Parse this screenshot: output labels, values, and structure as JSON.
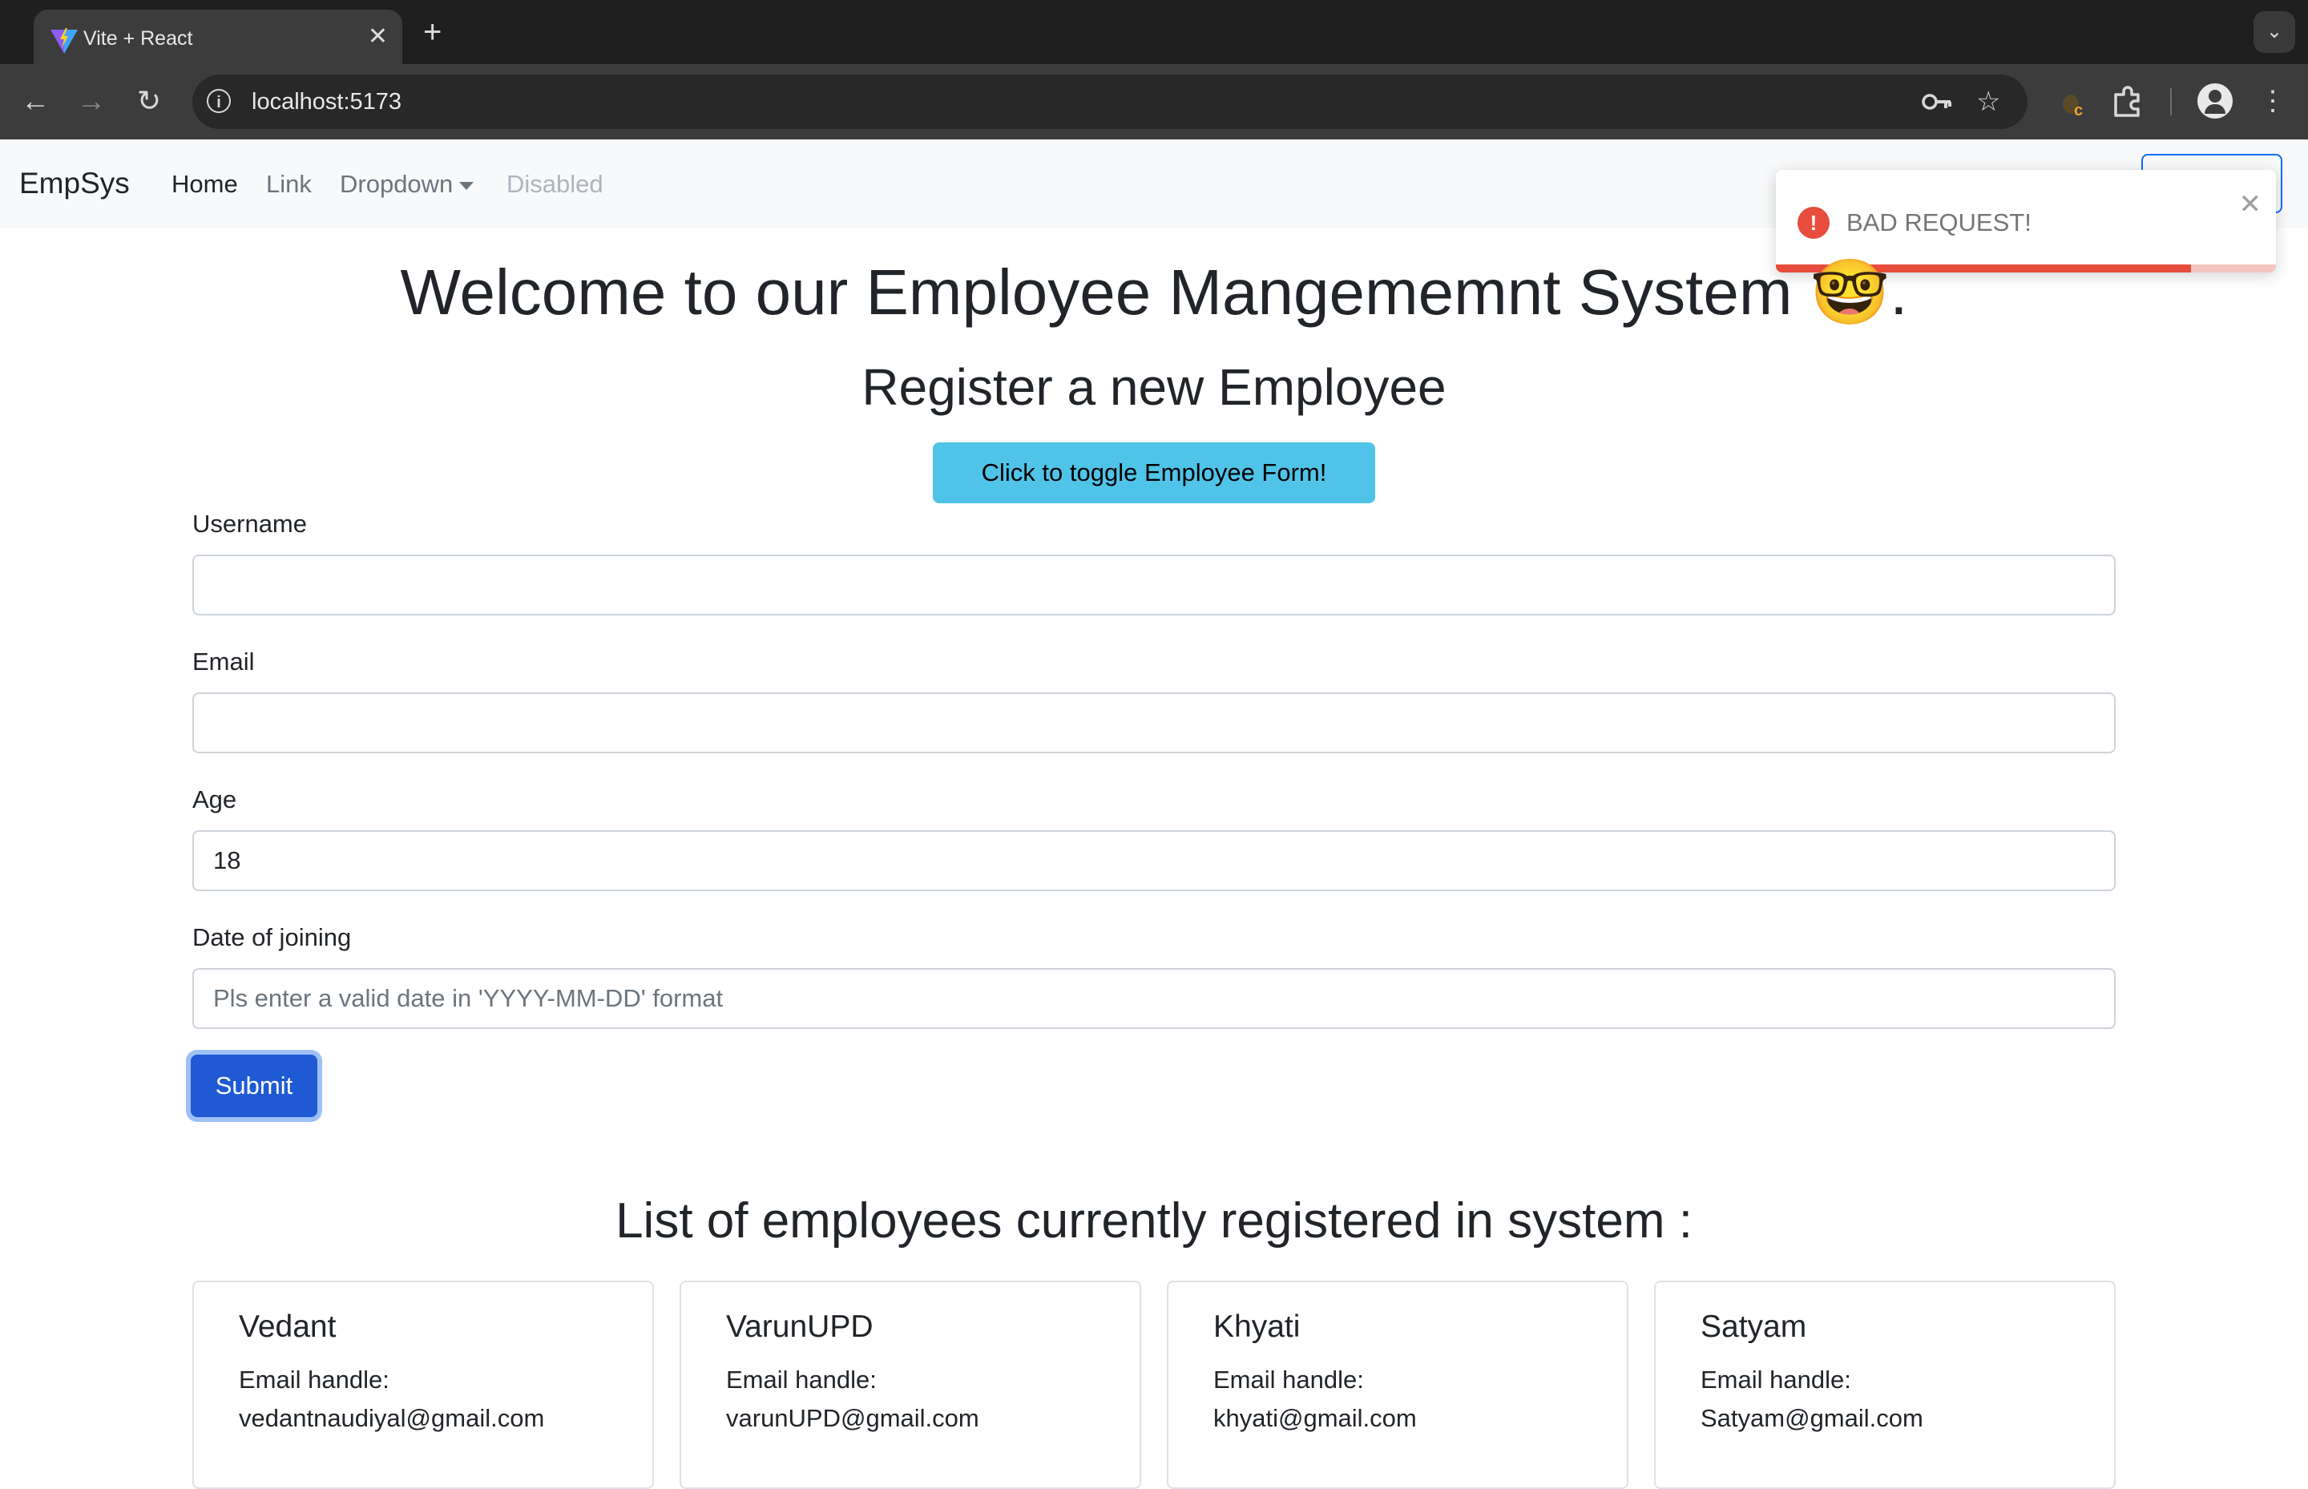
{
  "browser": {
    "tab_title": "Vite + React",
    "tab_close": "✕",
    "new_tab": "+",
    "tab_search": "⌄",
    "url": "localhost:5173",
    "icons": [
      "back-icon",
      "forward-icon",
      "reload-icon",
      "site-info-icon",
      "password-key-icon",
      "bookmark-star-icon",
      "extension-icon",
      "extensions-puzzle-icon",
      "profile-icon",
      "menu-kebab-icon"
    ]
  },
  "navbar": {
    "brand": "EmpSys",
    "links": [
      "Home",
      "Link",
      "Dropdown",
      "Disabled"
    ]
  },
  "toast": {
    "message": "BAD REQUEST!",
    "icon": "!",
    "close": "✕",
    "progress": 0.83,
    "color": "#e74c3c"
  },
  "main": {
    "title": "Welcome to our Employee Mangememnt System 🤓.",
    "subtitle": "Register a new Employee",
    "toggle_button": "Click to toggle Employee Form!"
  },
  "form": {
    "username_label": "Username",
    "username_value": "",
    "email_label": "Email",
    "email_value": "",
    "age_label": "Age",
    "age_value": "18",
    "doj_label": "Date of joining",
    "doj_placeholder": "Pls enter a valid date in 'YYYY-MM-DD' format",
    "submit": "Submit"
  },
  "list": {
    "title": "List of employees currently registered in system :",
    "email_label": "Email handle:",
    "employees": [
      {
        "name": "Vedant",
        "email": "vedantnaudiyal@gmail.com"
      },
      {
        "name": "VarunUPD",
        "email": "varunUPD@gmail.com"
      },
      {
        "name": "Khyati",
        "email": "khyati@gmail.com"
      },
      {
        "name": "Satyam",
        "email": "Satyam@gmail.com"
      }
    ]
  },
  "colors": {
    "primary": "#1f5ad4",
    "info": "#4fc3e8",
    "error": "#e74c3c"
  }
}
